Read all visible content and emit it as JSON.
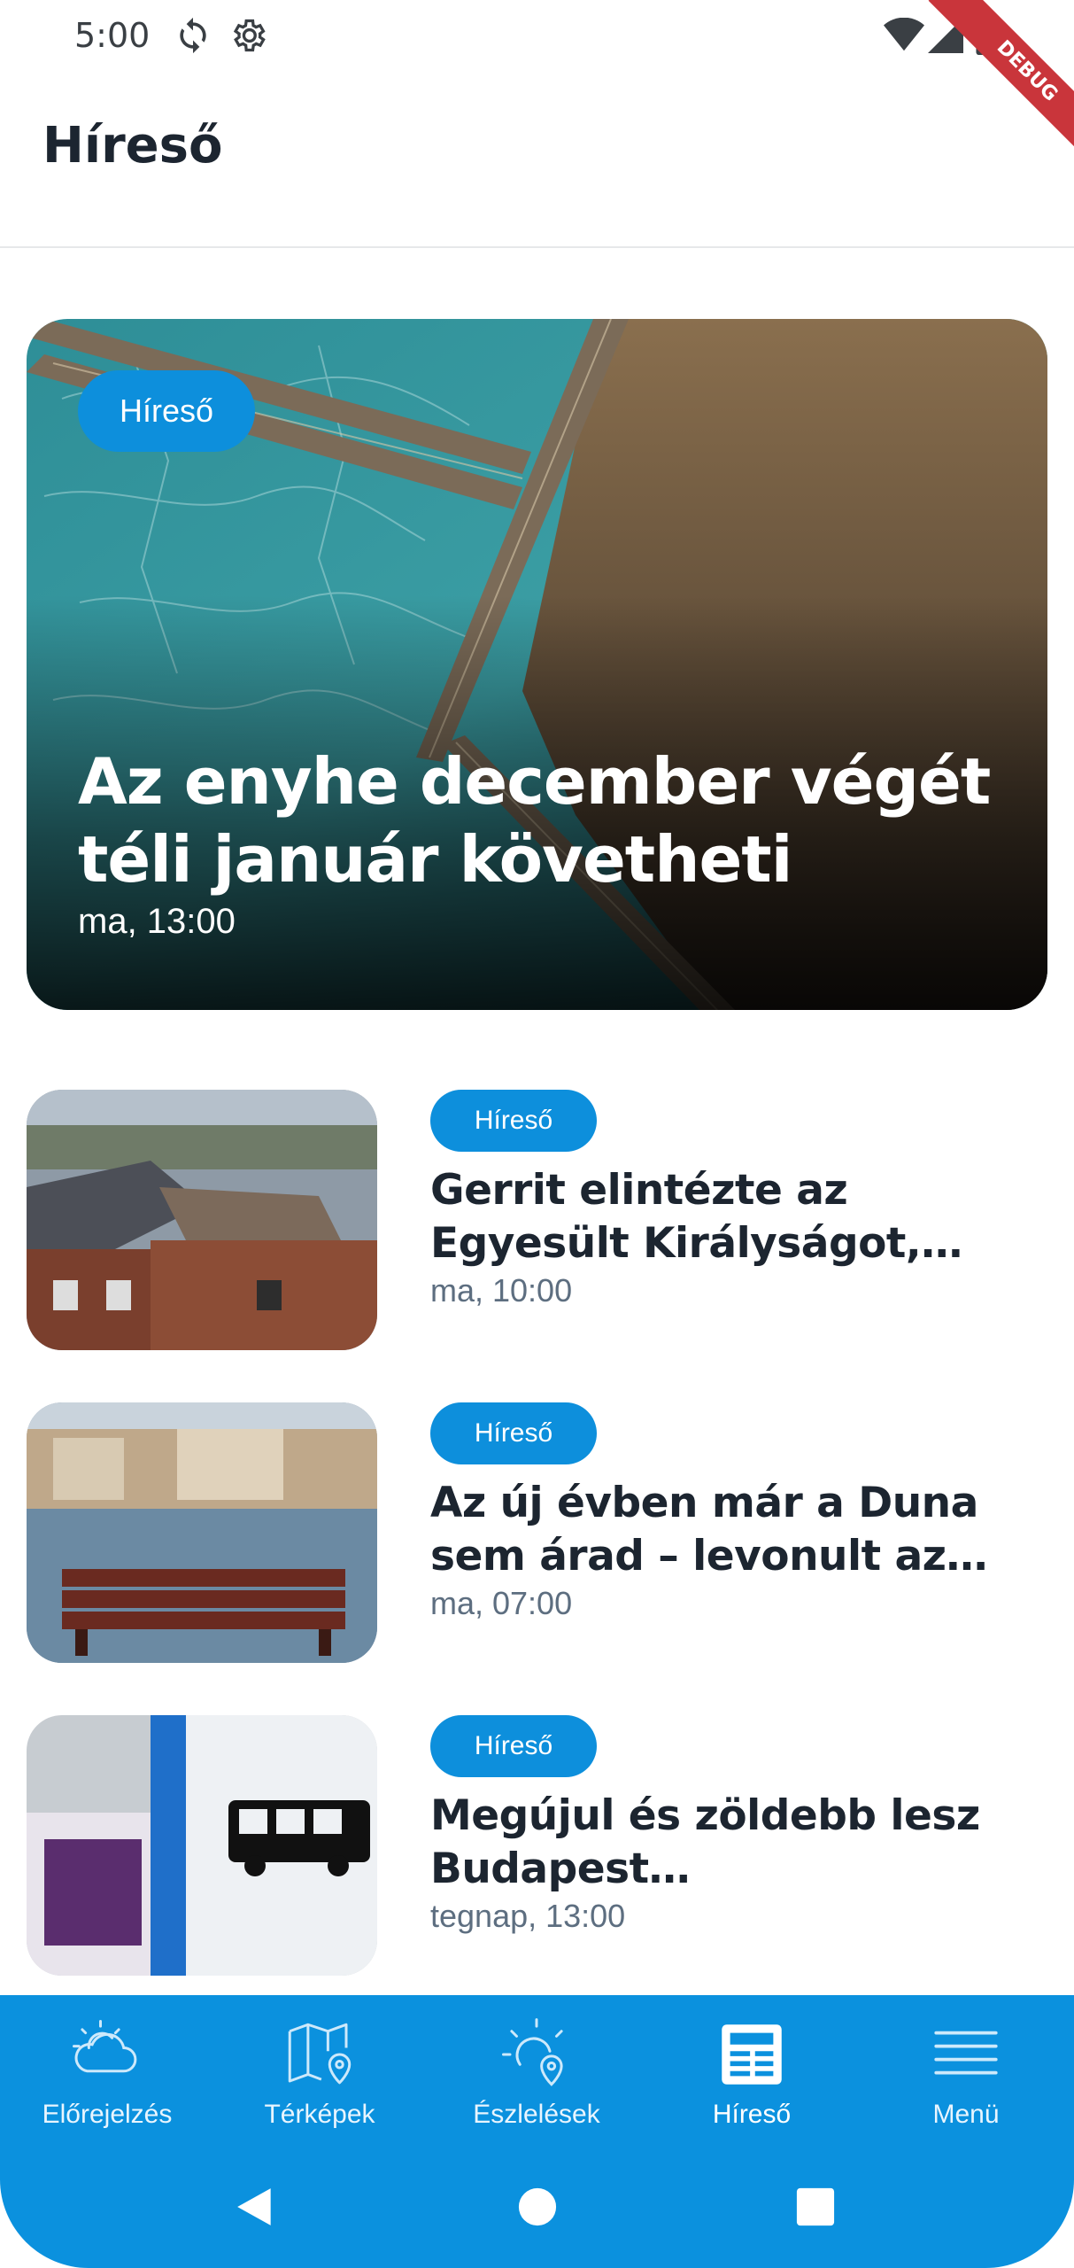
{
  "status_bar": {
    "time": "5:00",
    "icons": [
      "sync-icon",
      "settings-icon",
      "wifi-icon",
      "cell-signal-icon",
      "battery-icon"
    ],
    "debug_banner": "DEBUG"
  },
  "app_bar": {
    "title": "Híreső"
  },
  "hero": {
    "category": "Híreső",
    "title": "Az enyhe december végét téli január követheti",
    "time": "ma, 13:00",
    "image": "frozen-lake-pier-aerial-photo"
  },
  "news": [
    {
      "category": "Híreső",
      "title": "Gerrit elintézte az Egyesült Királyságot, tornádót is lét…",
      "time": "ma, 10:00",
      "image": "storm-damaged-houses-photo"
    },
    {
      "category": "Híreső",
      "title": "Az új évben már a Duna sem árad – levonult az árhullám",
      "time": "ma, 07:00",
      "image": "flooded-bench-danube-photo"
    },
    {
      "category": "Híreső",
      "title": "Megújul és zöldebb lesz Budapest tömegközlekedé…",
      "time": "tegnap, 13:00",
      "image": "bus-stop-sign-photo"
    }
  ],
  "bottom_nav": {
    "items": [
      {
        "label": "Előrejelzés",
        "icon": "cloud-sun-icon",
        "active": false
      },
      {
        "label": "Térképek",
        "icon": "map-pin-icon",
        "active": false
      },
      {
        "label": "Észlelések",
        "icon": "sun-pin-icon",
        "active": false
      },
      {
        "label": "Híreső",
        "icon": "newspaper-icon",
        "active": true
      },
      {
        "label": "Menü",
        "icon": "menu-icon",
        "active": false
      }
    ]
  },
  "system_nav": {
    "buttons": [
      "back-button",
      "home-button",
      "recents-button"
    ]
  },
  "colors": {
    "accent": "#0b91de",
    "pill": "#0d8fdc",
    "title": "#1c2530",
    "time": "#5d6e80"
  }
}
